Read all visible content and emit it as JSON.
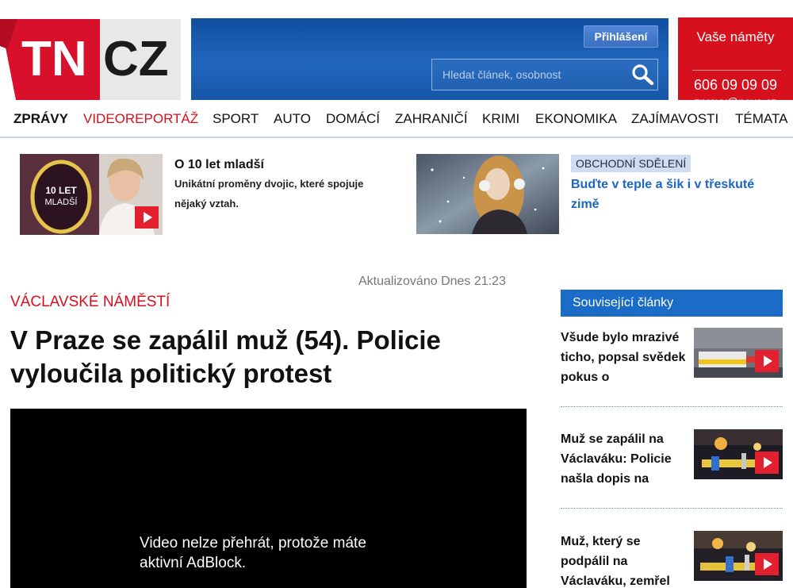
{
  "header": {
    "logo": {
      "part1": "TN",
      "part2": "CZ"
    },
    "login_label": "Přihlášení",
    "search": {
      "placeholder": "Hledat článek, osobnost",
      "value": ""
    },
    "contact": {
      "title": "Vaše náměty",
      "phone": "606 09 09 09",
      "email": "zpravy@nova.cz"
    }
  },
  "nav": [
    "ZPRÁVY",
    "VIDEOREPORTÁŽ",
    "SPORT",
    "AUTO",
    "DOMÁCÍ",
    "ZAHRANIČÍ",
    "KRIMI",
    "EKONOMIKA",
    "ZAJÍMAVOSTI",
    "TÉMATA"
  ],
  "promos": [
    {
      "title": "O 10 let mladší",
      "subtitle": "Unikátní proměny dvojic, které spojuje nějaký vztah.",
      "image_text": "10 LET MLADŠÍ"
    },
    {
      "badge": "OBCHODNÍ SDĚLENÍ",
      "title": "Buďte v teple a šik i v třeskuté zimě"
    }
  ],
  "article": {
    "updated": "Aktualizováno Dnes 21:23",
    "kicker": "VÁCLAVSKÉ NÁMĚSTÍ",
    "headline": "V Praze se zapálil muž (54). Policie vyloučila politický protest",
    "video_message": "Video nelze přehrát, protože máte aktivní AdBlock."
  },
  "related": {
    "header": "Související články",
    "items": [
      {
        "text": "Všude bylo mrazivé ticho, popsal svědek pokus o"
      },
      {
        "text": "Muž se zapálil na Václaváku: Policie našla dopis na"
      },
      {
        "text": "Muž, který se podpálil na Václaváku, zemřel"
      }
    ]
  },
  "colors": {
    "brand_red": "#d7101d",
    "header_blue": "#1a5cb0",
    "link_blue": "#1b66c2"
  },
  "icons": [
    "search-icon",
    "play-icon"
  ]
}
